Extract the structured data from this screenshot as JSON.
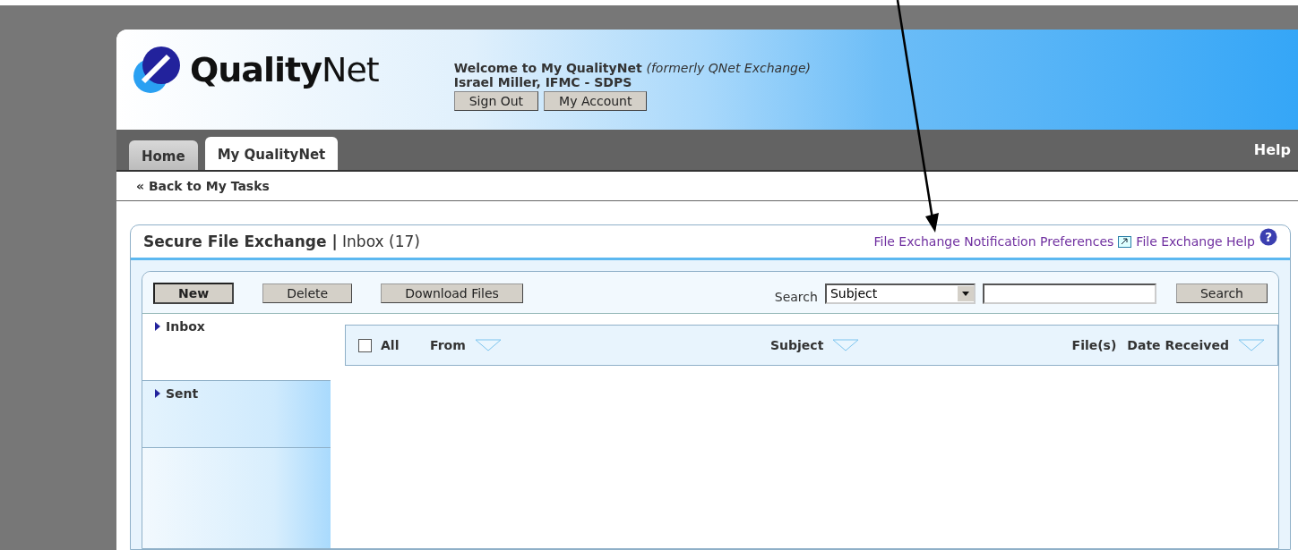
{
  "logo": {
    "brand_bold": "Quality",
    "brand_rest": "Net"
  },
  "welcome": {
    "title": "Welcome to My QualityNet",
    "note": "(formerly QNet Exchange)",
    "user": "Israel Miller, IFMC - SDPS"
  },
  "header_buttons": [
    "Sign Out",
    "My Account"
  ],
  "tabs": [
    {
      "label": "Home",
      "selected": false
    },
    {
      "label": "My QualityNet",
      "selected": true
    }
  ],
  "help_link": "Help",
  "back_link": "« Back to My Tasks",
  "panel": {
    "title": "Secure File Exchange",
    "separator": "|",
    "subtitle": "Inbox (17)",
    "links": [
      {
        "label": "File Exchange Notification Preferences"
      },
      {
        "label": "File Exchange Help"
      }
    ],
    "help_icon": "?"
  },
  "toolbar": {
    "buttons": [
      {
        "label": "New",
        "kind": "primary"
      },
      {
        "label": "Delete",
        "kind": "normal"
      },
      {
        "label": "Download Files",
        "kind": "normal"
      }
    ],
    "search_label": "Search",
    "search_field": "Subject",
    "search_button": "Search"
  },
  "folders": [
    {
      "label": "Inbox",
      "selected": true
    },
    {
      "label": "Sent",
      "selected": false
    }
  ],
  "table": {
    "select_all": {
      "label": "All",
      "checked": false
    },
    "columns": [
      {
        "label": "From",
        "sortable": true
      },
      {
        "label": "Subject",
        "sortable": true
      },
      {
        "label": "File(s)",
        "sortable": false
      },
      {
        "label": "Date Received",
        "sortable": true
      }
    ]
  }
}
